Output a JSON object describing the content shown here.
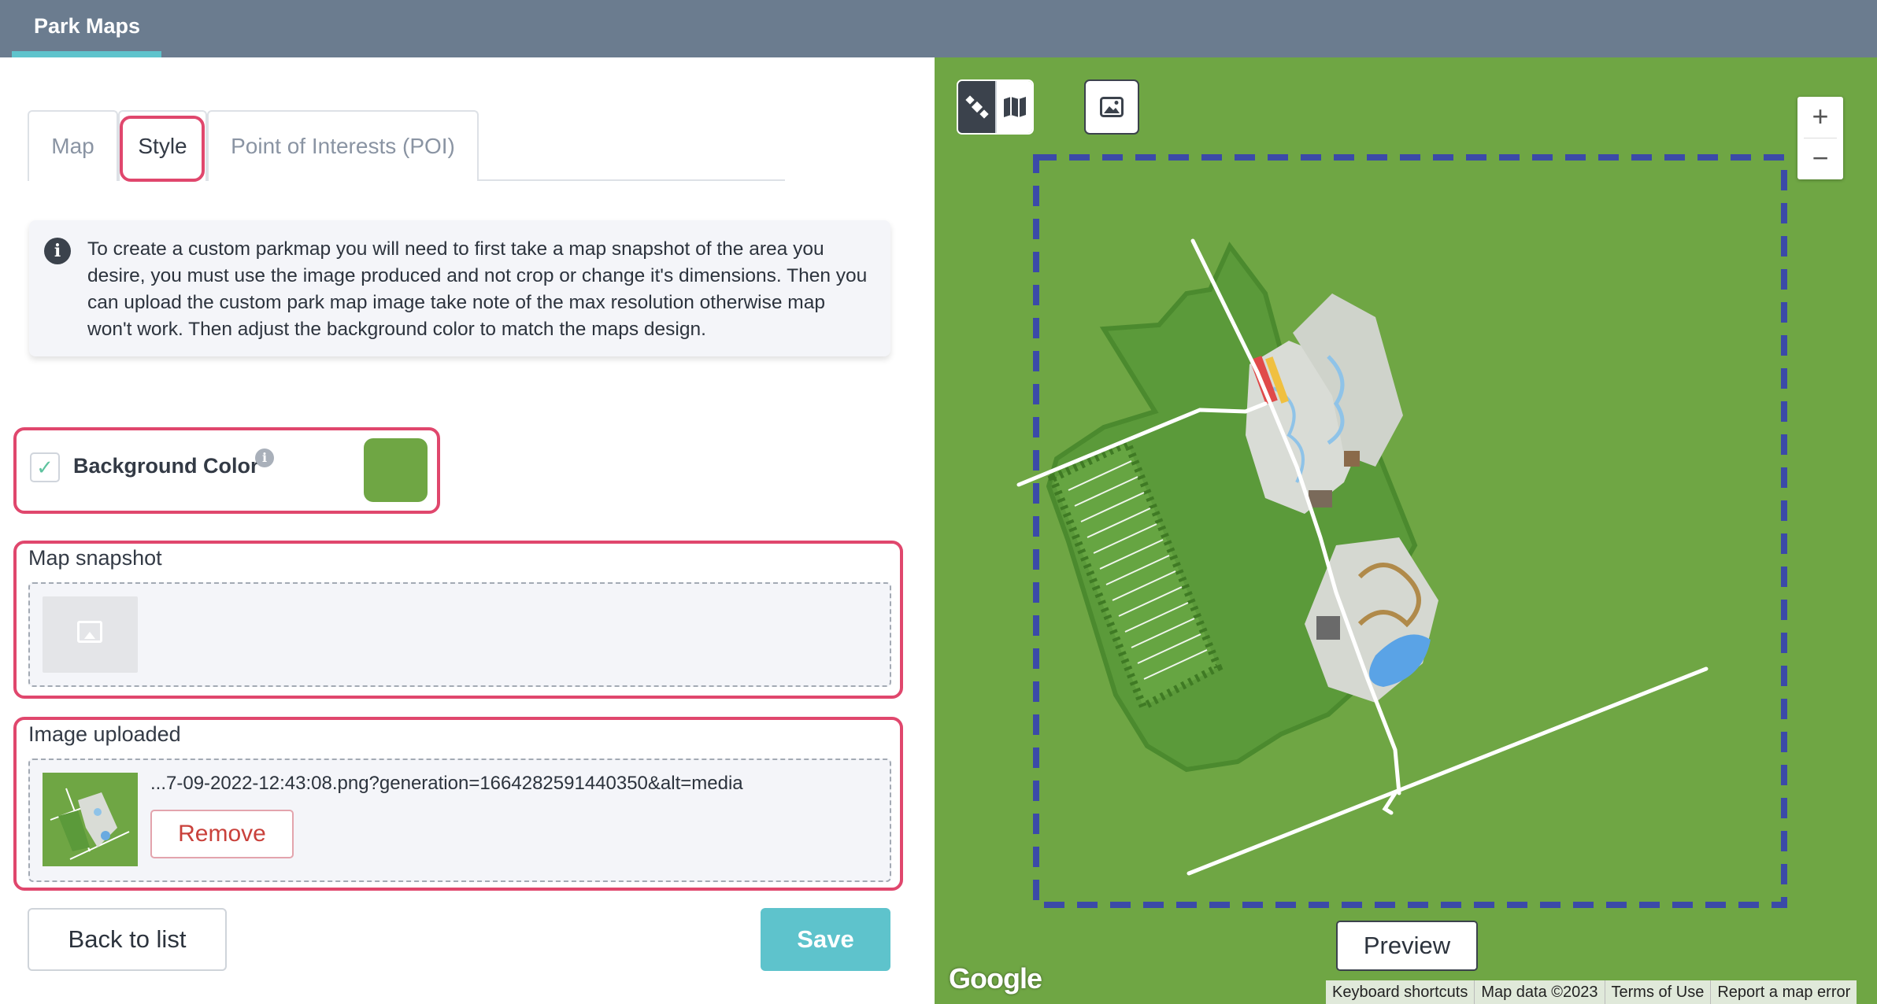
{
  "app": {
    "title": "Park Maps"
  },
  "tabs": [
    {
      "label": "Map"
    },
    {
      "label": "Style"
    },
    {
      "label": "Point of Interests (POI)"
    }
  ],
  "info": {
    "text": "To create a custom parkmap you will need to first take a map snapshot of the area you desire, you must use the image produced and not crop or change it's dimensions. Then you can upload the custom park map image take note of the max resolution otherwise map won't work. Then adjust the background color to match the maps design."
  },
  "background_color": {
    "label": "Background Color",
    "checked": true,
    "color": "#6fa644"
  },
  "map_snapshot": {
    "title": "Map snapshot"
  },
  "image_uploaded": {
    "title": "Image uploaded",
    "file_name": "...7-09-2022-12:43:08.png?generation=1664282591440350&alt=media",
    "remove_label": "Remove"
  },
  "actions": {
    "back_label": "Back to list",
    "save_label": "Save"
  },
  "map": {
    "zoom_in": "+",
    "zoom_out": "−",
    "preview_label": "Preview",
    "google_logo": "Google",
    "attribution": [
      "Keyboard shortcuts",
      "Map data ©2023",
      "Terms of Use",
      "Report a map error"
    ]
  },
  "colors": {
    "accent": "#5ec3cc",
    "highlight": "#e0476d",
    "header": "#6b7c8f",
    "map_green": "#6fa644",
    "danger": "#c9413b"
  }
}
